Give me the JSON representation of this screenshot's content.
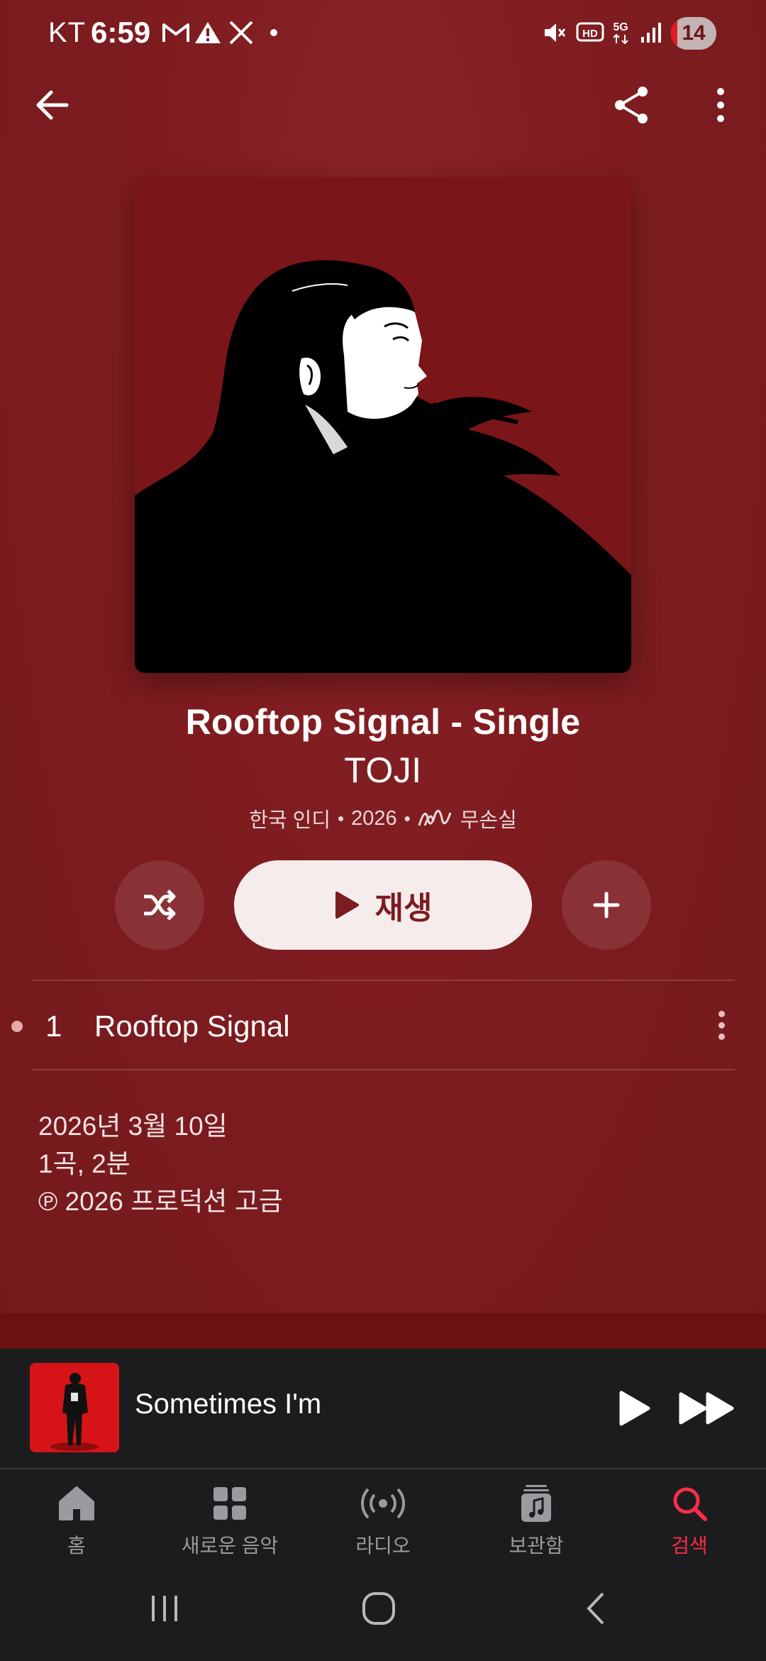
{
  "status_bar": {
    "carrier": "KT",
    "time": "6:59",
    "battery_level": "14",
    "network": "5G",
    "hd_badge": "HD"
  },
  "toolbar": {
    "back_icon": "arrow-left-icon",
    "share_icon": "share-icon",
    "more_icon": "more-vertical-icon"
  },
  "album": {
    "title": "Rooftop Signal - Single",
    "artist": "TOJI",
    "genre": "한국 인디",
    "year": "2026",
    "audio_badge": "무손실",
    "separator": "•"
  },
  "actions": {
    "shuffle_icon": "shuffle-icon",
    "play_label": "재생",
    "add_icon": "plus-icon"
  },
  "tracks": [
    {
      "number": "1",
      "title": "Rooftop Signal"
    }
  ],
  "release": {
    "date": "2026년 3월 10일",
    "count": "1곡, 2분",
    "copyright": "℗ 2026 프로덕션 고금"
  },
  "mini_player": {
    "title": "Sometimes I'm"
  },
  "tabs": [
    {
      "label": "홈",
      "icon": "home-icon"
    },
    {
      "label": "새로운 음악",
      "icon": "grid-icon"
    },
    {
      "label": "라디오",
      "icon": "radio-icon"
    },
    {
      "label": "보관함",
      "icon": "library-icon"
    },
    {
      "label": "검색",
      "icon": "search-icon",
      "active": true
    }
  ],
  "colors": {
    "background": "#7e1c20",
    "accent": "#fa2d48",
    "play_button_bg": "#f6ecec",
    "play_button_text": "#7b1c20"
  }
}
